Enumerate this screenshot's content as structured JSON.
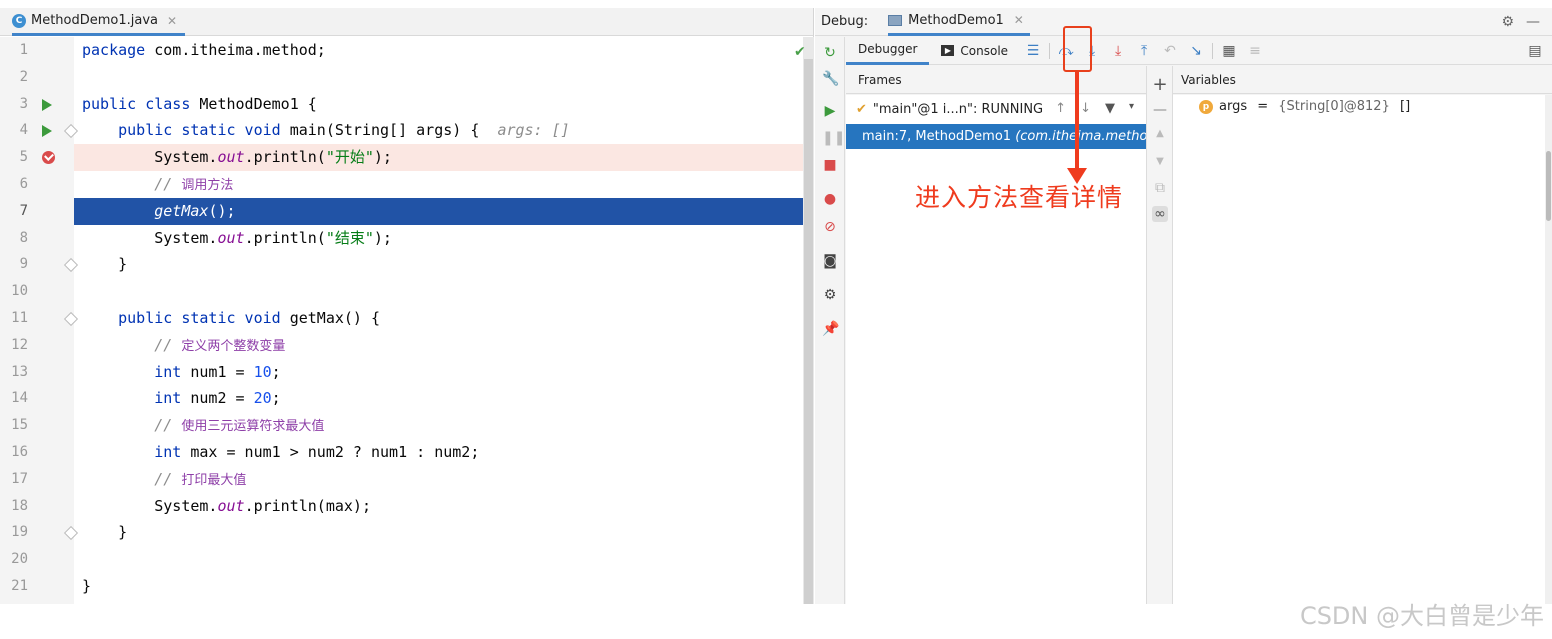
{
  "editor": {
    "tab_label": "MethodDemo1.java",
    "lines": [
      {
        "n": "1",
        "html": "<span class=\"kw\">package</span> com.itheima.method;"
      },
      {
        "n": "2",
        "html": ""
      },
      {
        "n": "3",
        "html": "<span class=\"kw\">public class</span> MethodDemo1 {",
        "run": true
      },
      {
        "n": "4",
        "html": "    <span class=\"kw\">public static void</span> main(String[] args) {  <span class=\"hint\">args: []</span>",
        "run": true,
        "fold": true
      },
      {
        "n": "5",
        "html": "        System.<span class=\"fld\">out</span>.println(<span class=\"str\">\"开始\"</span>);",
        "bp": true
      },
      {
        "n": "6",
        "html": "        <span class=\"cmt\">//</span> <span class=\"cmt-cn\">调用方法</span>"
      },
      {
        "n": "7",
        "html": "        <span class=\"fn\">getMax</span>();",
        "exec": true
      },
      {
        "n": "8",
        "html": "        System.<span class=\"fld\">out</span>.println(<span class=\"str\">\"结束\"</span>);"
      },
      {
        "n": "9",
        "html": "    }",
        "fold": true
      },
      {
        "n": "10",
        "html": ""
      },
      {
        "n": "11",
        "html": "    <span class=\"kw\">public static void</span> getMax() {",
        "fold": true
      },
      {
        "n": "12",
        "html": "        <span class=\"cmt\">//</span> <span class=\"cmt-cn\">定义两个整数变量</span>"
      },
      {
        "n": "13",
        "html": "        <span class=\"kw\">int</span> num1 = <span class=\"num\">10</span>;"
      },
      {
        "n": "14",
        "html": "        <span class=\"kw\">int</span> num2 = <span class=\"num\">20</span>;"
      },
      {
        "n": "15",
        "html": "        <span class=\"cmt\">//</span> <span class=\"cmt-cn\">使用三元运算符求最大值</span>"
      },
      {
        "n": "16",
        "html": "        <span class=\"kw\">int</span> max = num1 > num2 ? num1 : num2;"
      },
      {
        "n": "17",
        "html": "        <span class=\"cmt\">//</span> <span class=\"cmt-cn\">打印最大值</span>"
      },
      {
        "n": "18",
        "html": "        System.<span class=\"fld\">out</span>.println(max);"
      },
      {
        "n": "19",
        "html": "    }",
        "fold": true
      },
      {
        "n": "20",
        "html": ""
      },
      {
        "n": "21",
        "html": "}"
      }
    ]
  },
  "debug": {
    "title_label": "Debug:",
    "tab_label": "MethodDemo1",
    "debugger_tab": "Debugger",
    "console_tab": "Console",
    "frames_header": "Frames",
    "variables_header": "Variables",
    "thread_label": "\"main\"@1 i...n\": RUNNING",
    "frame_label": "main:7, MethodDemo1",
    "frame_package": "(com.itheima.method)",
    "var_name": "args",
    "var_eq": " = ",
    "var_type": "{String[0]@812}",
    "var_value": " []"
  },
  "annotation": {
    "text": "进入方法查看详情",
    "color": "#ef3b1e"
  },
  "watermark": "CSDN @大白曾是少年"
}
